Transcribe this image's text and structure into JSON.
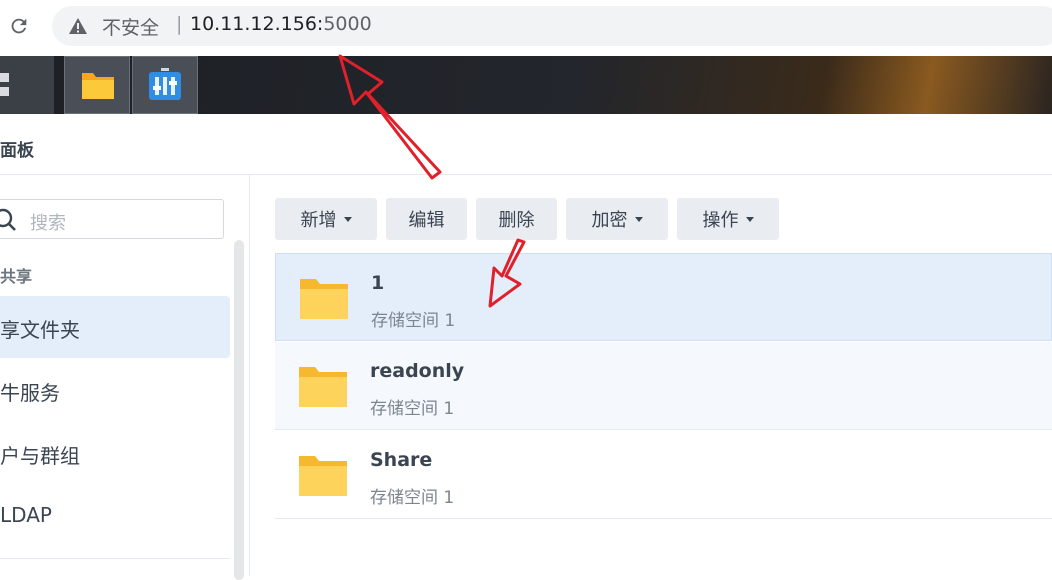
{
  "browser": {
    "insecure_label": "不安全",
    "separator": "|",
    "url_host": "10.11.12.156:",
    "url_port": "5000"
  },
  "window": {
    "title": "面板"
  },
  "sidebar": {
    "search_placeholder": "搜索",
    "group_label": "共享",
    "items": [
      {
        "label": "享文件夹",
        "active": true
      },
      {
        "label": "牛服务",
        "active": false
      },
      {
        "label": "户与群组",
        "active": false
      },
      {
        "label": "LDAP",
        "active": false
      }
    ]
  },
  "toolbar": {
    "buttons": [
      {
        "label": "新增",
        "dropdown": true
      },
      {
        "label": "编辑",
        "dropdown": false
      },
      {
        "label": "删除",
        "dropdown": false
      },
      {
        "label": "加密",
        "dropdown": true
      },
      {
        "label": "操作",
        "dropdown": true
      }
    ]
  },
  "folders": [
    {
      "name": "1",
      "location": "存储空间 1",
      "selected": true
    },
    {
      "name": "readonly",
      "location": "存储空间 1",
      "selected": false
    },
    {
      "name": "Share",
      "location": "存储空间 1",
      "selected": false
    }
  ],
  "colors": {
    "accent_selected": "#e3eefa",
    "folder_yellow": "#fbc02d",
    "annotation_red": "#e0202a"
  }
}
